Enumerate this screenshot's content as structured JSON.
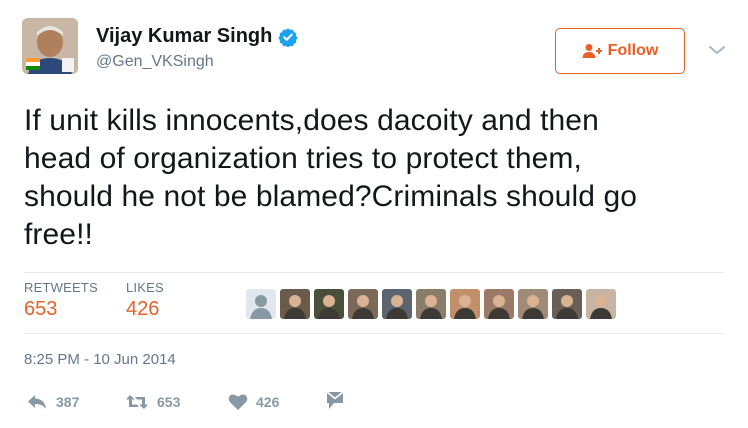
{
  "author": {
    "name": "Vijay Kumar Singh",
    "handle": "@Gen_VKSingh",
    "verified": true
  },
  "follow_button": {
    "label": "Follow",
    "icon": "add-user-icon"
  },
  "tweet": {
    "lines": [
      "If unit kills innocents,does dacoity and then",
      "head of organization tries to protect them,",
      "should he not be blamed?Criminals should go",
      "free!!"
    ]
  },
  "stats": {
    "retweets": {
      "label": "RETWEETS",
      "value": "653"
    },
    "likes": {
      "label": "LIKES",
      "value": "426"
    }
  },
  "liker_colors": [
    "#aab8c2",
    "#6b5b4c",
    "#4a4f3a",
    "#7c6a58",
    "#5c6470",
    "#8a7e6a",
    "#c28f6b",
    "#9a7a66",
    "#a08a78",
    "#6a5f55",
    "#c9b3a3"
  ],
  "timestamp": "8:25 PM - 10 Jun 2014",
  "actions": {
    "reply": {
      "icon": "reply-icon",
      "count": "387"
    },
    "retweet": {
      "icon": "retweet-icon",
      "count": "653"
    },
    "like": {
      "icon": "heart-icon",
      "count": "426"
    },
    "message": {
      "icon": "direct-message-icon"
    }
  },
  "colors": {
    "accent": "#e95f28",
    "verified": "#1da1f2",
    "muted": "#657786",
    "icon": "#8899a6"
  }
}
